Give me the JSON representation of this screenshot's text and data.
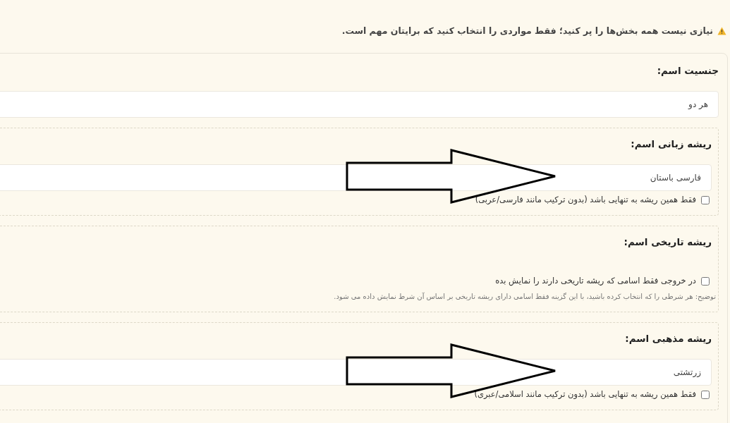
{
  "notice": {
    "text": "نیازی نیست همه بخش‌ها را پر کنید؛ فقط مواردی را انتخاب کنید که برایتان مهم است."
  },
  "sections": [
    {
      "kind": "plain",
      "label": "جنسیت اسم:",
      "value": "هر دو",
      "arrow": false
    },
    {
      "kind": "boxed",
      "label": "ریشه زبانی اسم:",
      "value": "فارسی باستان",
      "checkbox": {
        "label": "فقط همین ریشه به تنهایی باشد (بدون ترکیب مانند فارسی/عربی)",
        "checked": false
      },
      "arrow": true
    },
    {
      "kind": "boxed",
      "label": "ریشه تاریخی اسم:",
      "checkbox": {
        "label": "در خروجی فقط اسامی که ریشه تاریخی دارند را نمایش بده",
        "checked": false
      },
      "hint": "توضیح: هر شرطی را که انتخاب کرده باشید، با این گزینه فقط اسامی دارای ریشه تاریخی بر اساس آن شرط نمایش داده می شود.",
      "arrow": false
    },
    {
      "kind": "boxed",
      "label": "ریشه مذهبی اسم:",
      "value": "زرتشتی",
      "checkbox": {
        "label": "فقط همین ریشه به تنهایی باشد (بدون ترکیب مانند اسلامی/عبری)",
        "checked": false
      },
      "arrow": true
    }
  ]
}
